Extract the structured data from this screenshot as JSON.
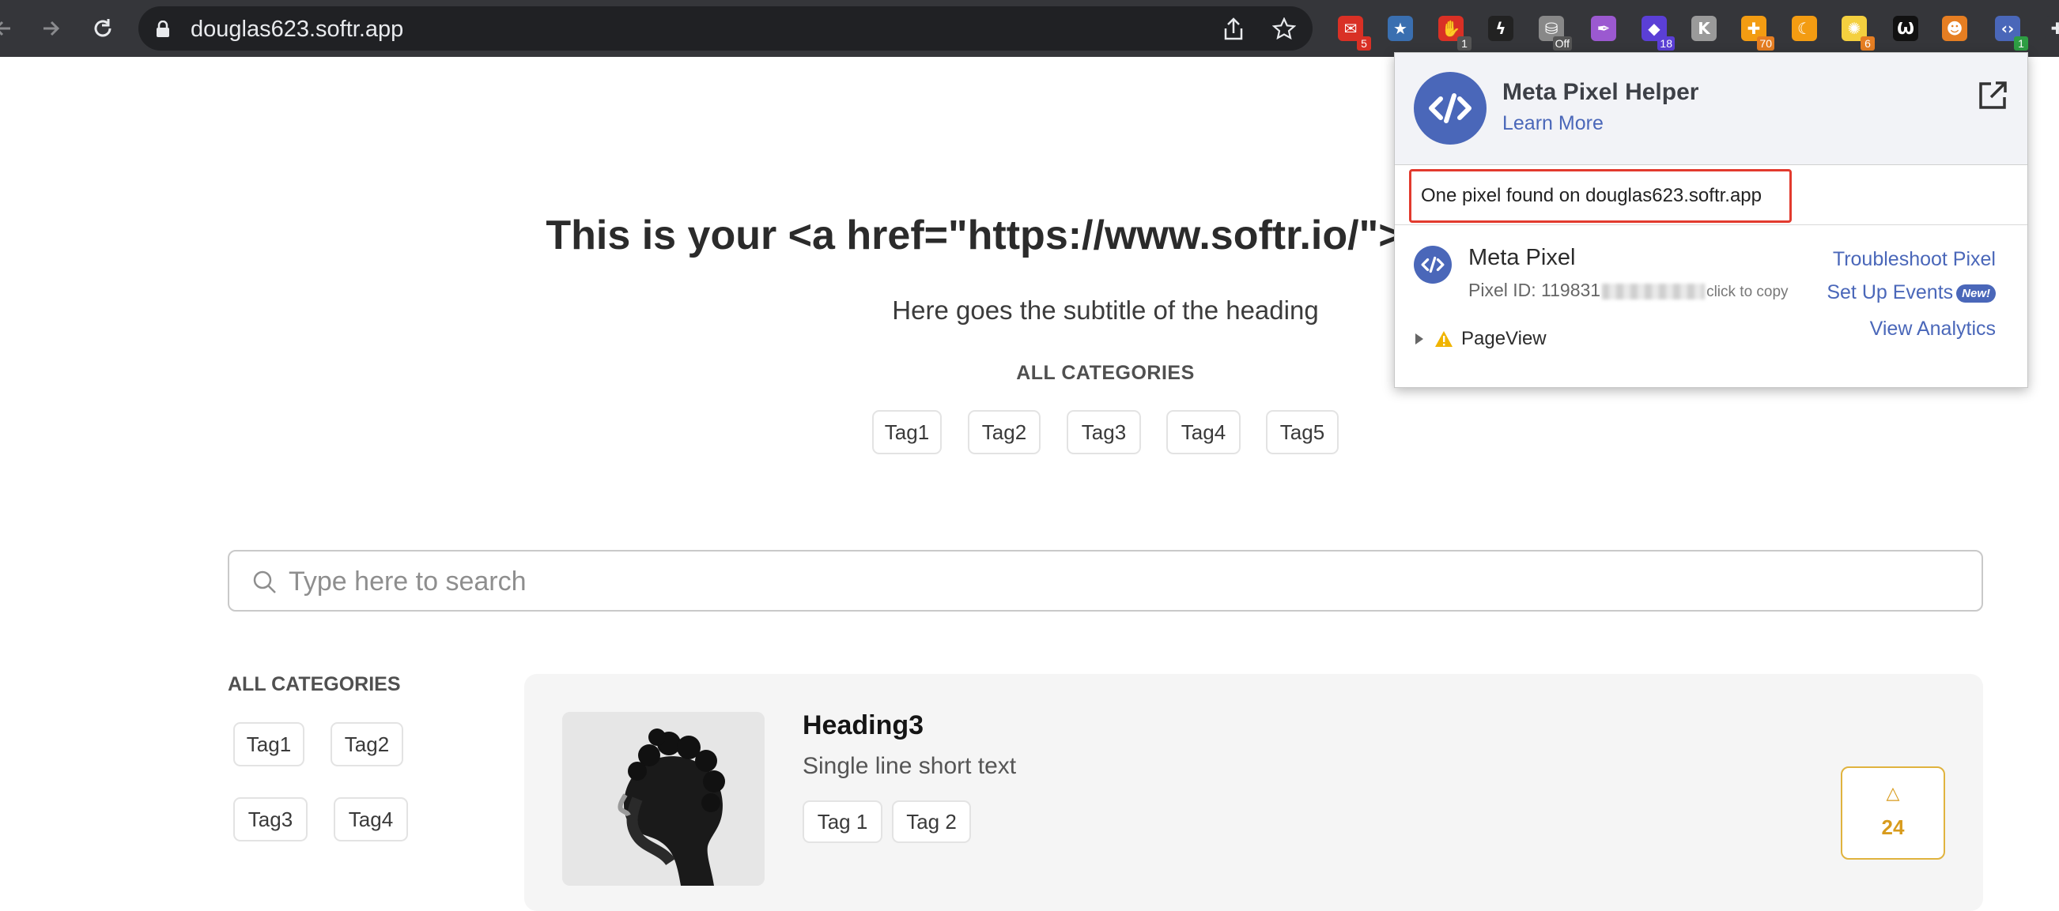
{
  "browser": {
    "url": "douglas623.softr.app",
    "extensions": [
      {
        "name": "gmail-extension-icon",
        "badge": "5",
        "color": "#d93025"
      },
      {
        "name": "star-bookmark-extension-icon",
        "badge": "",
        "color": "#3a6fb0"
      },
      {
        "name": "adblock-extension-icon",
        "badge": "1",
        "color": "#d93025"
      },
      {
        "name": "bolt-extension-icon",
        "badge": "",
        "color": "#222222"
      },
      {
        "name": "database-extension-icon",
        "badge": "Off",
        "color": "#888888"
      },
      {
        "name": "quill-extension-icon",
        "badge": "",
        "color": "#9b59d0"
      },
      {
        "name": "shield-extension-icon",
        "badge": "18",
        "color": "#5b3fd6"
      },
      {
        "name": "k-extension-icon",
        "badge": "",
        "color": "#9a9a9a"
      },
      {
        "name": "puzzle-extension-icon",
        "badge": "70",
        "color": "#f39c12"
      },
      {
        "name": "moon-extension-icon",
        "badge": "",
        "color": "#f39c12"
      },
      {
        "name": "lightbulb-extension-icon",
        "badge": "6",
        "color": "#f4d03f"
      },
      {
        "name": "wolf-extension-icon",
        "badge": "",
        "color": "#111111"
      },
      {
        "name": "robot-extension-icon",
        "badge": "",
        "color": "#e67e22"
      },
      {
        "name": "meta-pixel-extension-icon",
        "badge": "1",
        "color": "#4a67b9"
      }
    ]
  },
  "page": {
    "title": "This is your <a href=\"https://www.softr.io/\">",
    "subtitle": "Here goes the subtitle of the heading",
    "categories_label": "ALL CATEGORIES",
    "top_tags": [
      "Tag1",
      "Tag2",
      "Tag3",
      "Tag4",
      "Tag5"
    ],
    "search_placeholder": "Type here to search",
    "sidebar": {
      "label": "ALL CATEGORIES",
      "tags": [
        "Tag1",
        "Tag2",
        "Tag3",
        "Tag4"
      ]
    },
    "card": {
      "heading": "Heading3",
      "text": "Single line short text",
      "tags": [
        "Tag 1",
        "Tag 2"
      ],
      "votes": "24"
    }
  },
  "popup": {
    "title": "Meta Pixel Helper",
    "learn_more": "Learn More",
    "found": "One pixel found on douglas623.softr.app",
    "pixel_name": "Meta Pixel",
    "pixel_id_prefix": "Pixel ID: 119831",
    "copy_hint": "click to copy",
    "troubleshoot": "Troubleshoot Pixel",
    "setup_events": "Set Up Events",
    "new_badge": "New!",
    "view_analytics": "View Analytics",
    "event": "PageView"
  },
  "colors": {
    "accent": "#4a67b9",
    "highlight_border": "#e23a2e",
    "vote": "#d89b1c"
  }
}
